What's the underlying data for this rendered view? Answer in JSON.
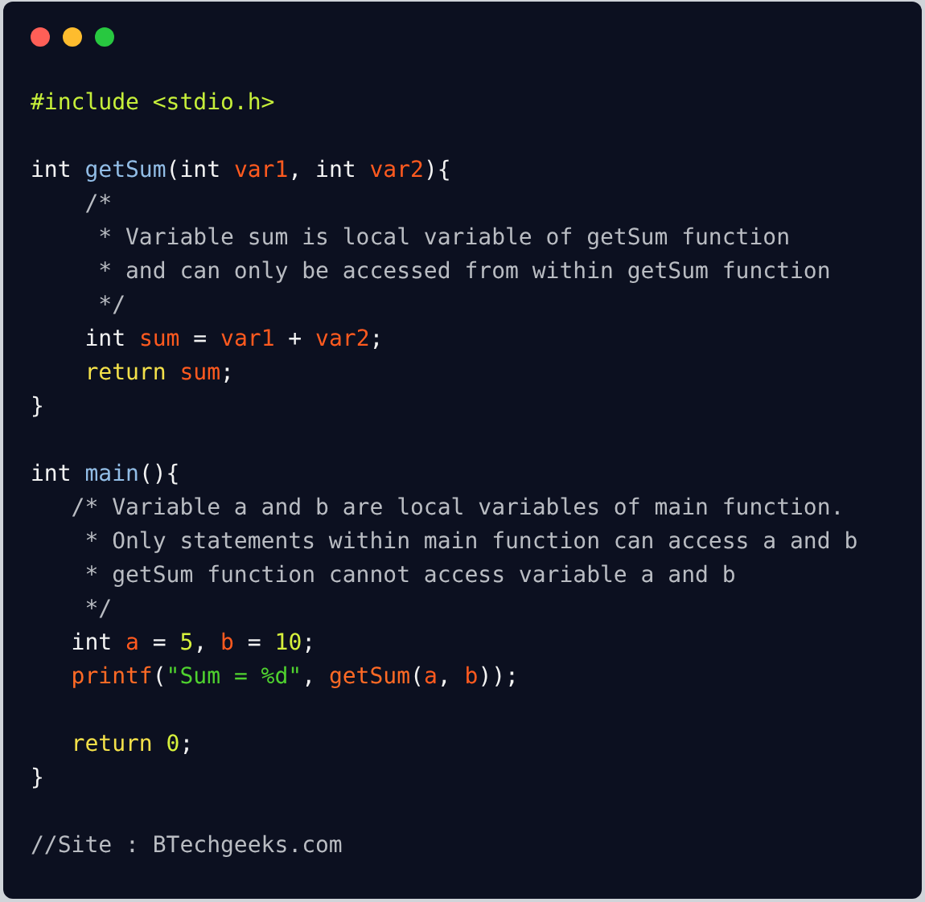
{
  "window_buttons": [
    {
      "color": "#ff5f57"
    },
    {
      "color": "#febc2e"
    },
    {
      "color": "#28c840"
    }
  ],
  "lines": [
    {
      "kind": "code",
      "tokens": [
        {
          "kind": "preprocessor",
          "text": "#include <stdio.h>"
        }
      ]
    },
    {
      "kind": "blank"
    },
    {
      "kind": "code",
      "tokens": [
        {
          "kind": "type",
          "text": "int "
        },
        {
          "kind": "function",
          "text": "getSum"
        },
        {
          "kind": "punct",
          "text": "("
        },
        {
          "kind": "type",
          "text": "int "
        },
        {
          "kind": "variable",
          "text": "var1"
        },
        {
          "kind": "punct",
          "text": ", "
        },
        {
          "kind": "type",
          "text": "int "
        },
        {
          "kind": "variable",
          "text": "var2"
        },
        {
          "kind": "punct",
          "text": "){"
        }
      ]
    },
    {
      "kind": "code",
      "tokens": [
        {
          "kind": "comment",
          "text": "    /*"
        }
      ]
    },
    {
      "kind": "code",
      "tokens": [
        {
          "kind": "comment",
          "text": "     * Variable sum is local variable of getSum function"
        }
      ]
    },
    {
      "kind": "code",
      "tokens": [
        {
          "kind": "comment",
          "text": "     * and can only be accessed from within getSum function"
        }
      ]
    },
    {
      "kind": "code",
      "tokens": [
        {
          "kind": "comment",
          "text": "     */"
        }
      ]
    },
    {
      "kind": "code",
      "tokens": [
        {
          "kind": "type",
          "text": "    int "
        },
        {
          "kind": "variable",
          "text": "sum"
        },
        {
          "kind": "punct",
          "text": " = "
        },
        {
          "kind": "variable",
          "text": "var1"
        },
        {
          "kind": "punct",
          "text": " + "
        },
        {
          "kind": "variable",
          "text": "var2"
        },
        {
          "kind": "punct",
          "text": ";"
        }
      ]
    },
    {
      "kind": "code",
      "tokens": [
        {
          "kind": "keyword",
          "text": "    return "
        },
        {
          "kind": "variable",
          "text": "sum"
        },
        {
          "kind": "punct",
          "text": ";"
        }
      ]
    },
    {
      "kind": "code",
      "tokens": [
        {
          "kind": "punct",
          "text": "}"
        }
      ]
    },
    {
      "kind": "blank"
    },
    {
      "kind": "code",
      "tokens": [
        {
          "kind": "type",
          "text": "int "
        },
        {
          "kind": "function",
          "text": "main"
        },
        {
          "kind": "punct",
          "text": "(){"
        }
      ]
    },
    {
      "kind": "code",
      "tokens": [
        {
          "kind": "comment",
          "text": "   /* Variable a and b are local variables of main function."
        }
      ]
    },
    {
      "kind": "code",
      "tokens": [
        {
          "kind": "comment",
          "text": "    * Only statements within main function can access a and b"
        }
      ]
    },
    {
      "kind": "code",
      "tokens": [
        {
          "kind": "comment",
          "text": "    * getSum function cannot access variable a and b"
        }
      ]
    },
    {
      "kind": "code",
      "tokens": [
        {
          "kind": "comment",
          "text": "    */"
        }
      ]
    },
    {
      "kind": "code",
      "tokens": [
        {
          "kind": "type",
          "text": "   int "
        },
        {
          "kind": "variable",
          "text": "a"
        },
        {
          "kind": "punct",
          "text": " = "
        },
        {
          "kind": "number",
          "text": "5"
        },
        {
          "kind": "punct",
          "text": ", "
        },
        {
          "kind": "variable",
          "text": "b"
        },
        {
          "kind": "punct",
          "text": " = "
        },
        {
          "kind": "number",
          "text": "10"
        },
        {
          "kind": "punct",
          "text": ";"
        }
      ]
    },
    {
      "kind": "code",
      "tokens": [
        {
          "kind": "call",
          "text": "   printf"
        },
        {
          "kind": "punct",
          "text": "("
        },
        {
          "kind": "string",
          "text": "\"Sum = %d\""
        },
        {
          "kind": "punct",
          "text": ", "
        },
        {
          "kind": "call",
          "text": "getSum"
        },
        {
          "kind": "punct",
          "text": "("
        },
        {
          "kind": "variable",
          "text": "a"
        },
        {
          "kind": "punct",
          "text": ", "
        },
        {
          "kind": "variable",
          "text": "b"
        },
        {
          "kind": "punct",
          "text": "));"
        }
      ]
    },
    {
      "kind": "blank"
    },
    {
      "kind": "code",
      "tokens": [
        {
          "kind": "keyword",
          "text": "   return "
        },
        {
          "kind": "number",
          "text": "0"
        },
        {
          "kind": "punct",
          "text": ";"
        }
      ]
    },
    {
      "kind": "code",
      "tokens": [
        {
          "kind": "punct",
          "text": "}"
        }
      ]
    },
    {
      "kind": "blank"
    },
    {
      "kind": "code",
      "tokens": [
        {
          "kind": "comment",
          "text": "//Site : BTechgeeks.com"
        }
      ]
    }
  ]
}
